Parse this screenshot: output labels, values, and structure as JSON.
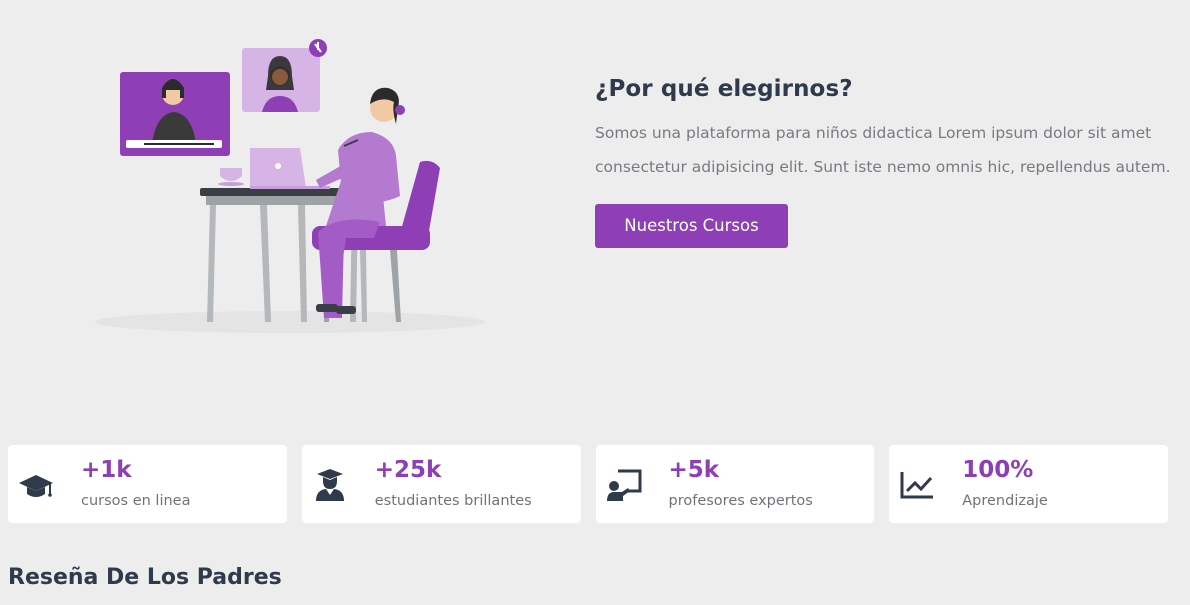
{
  "why": {
    "title": "¿Por qué elegirnos?",
    "description": "Somos una plataforma para niños didactica Lorem ipsum dolor sit amet consectetur adipisicing elit. Sunt iste nemo omnis hic, repellendus autem.",
    "button_label": "Nuestros Cursos"
  },
  "stats": [
    {
      "icon": "graduation-cap-icon",
      "value": "+1k",
      "label": "cursos en linea"
    },
    {
      "icon": "graduate-student-icon",
      "value": "+25k",
      "label": "estudiantes brillantes"
    },
    {
      "icon": "teacher-board-icon",
      "value": "+5k",
      "label": "profesores expertos"
    },
    {
      "icon": "line-chart-icon",
      "value": "100%",
      "label": "Aprendizaje"
    }
  ],
  "reviews": {
    "title": "Reseña De Los Padres"
  },
  "colors": {
    "accent": "#8e3fb5",
    "background": "#ededed",
    "heading": "#2f3a4a",
    "body_text": "#777b80"
  }
}
